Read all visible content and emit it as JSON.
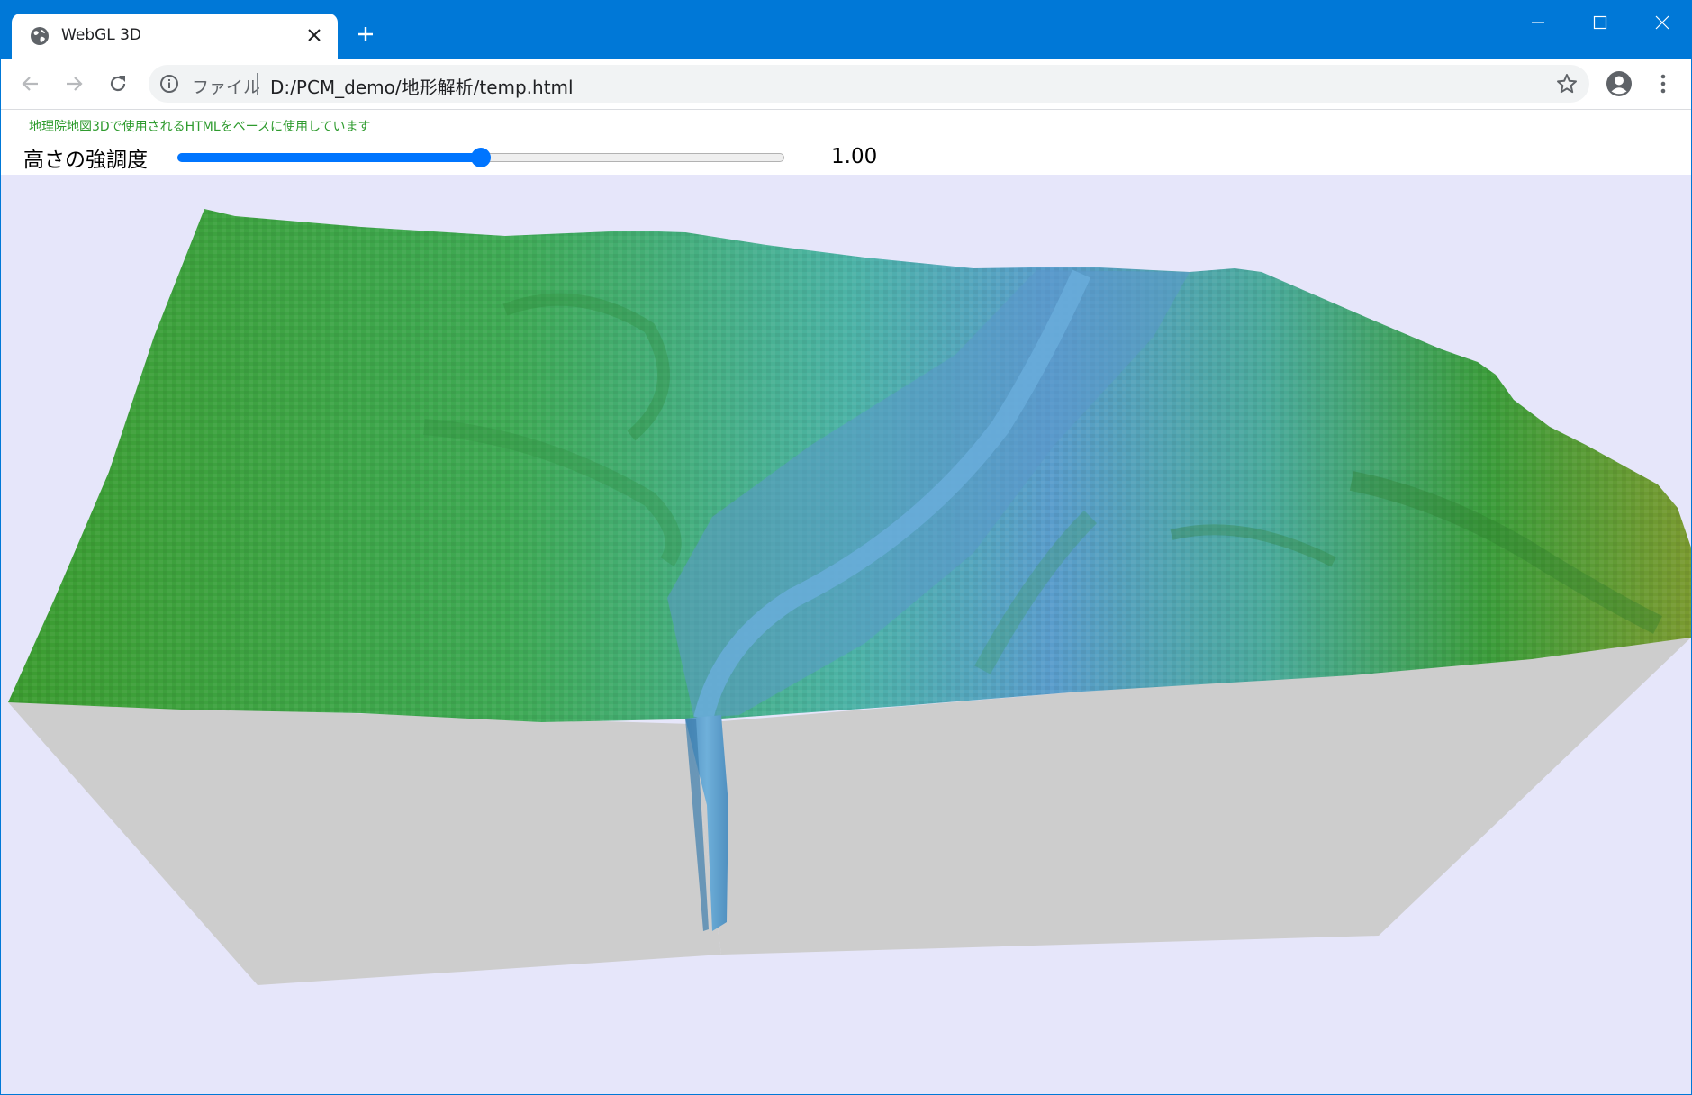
{
  "browser": {
    "tab": {
      "title": "WebGL 3D",
      "icon": "globe-icon"
    },
    "omnibox": {
      "scheme_label": "ファイル",
      "url": "D:/PCM_demo/地形解析/temp.html"
    }
  },
  "page": {
    "notice": "地理院地図3Dで使用されるHTMLをベースに使用しています",
    "control": {
      "label": "高さの強調度",
      "value_text": "1.00",
      "slider_fraction": 0.5
    }
  },
  "colors": {
    "titlebar": "#0078d7",
    "slider_accent": "#0075ff",
    "background": "#e6e6fa",
    "terrain_high": "#3a9a2a",
    "terrain_low": "#5a9ad0",
    "side_wall": "#cdcdcd"
  }
}
